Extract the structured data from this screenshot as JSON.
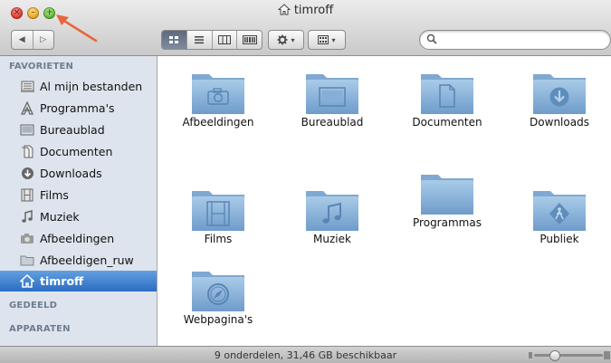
{
  "window": {
    "title": "timroff"
  },
  "toolbar": {
    "back": "◀",
    "forward": "▷",
    "search_placeholder": ""
  },
  "sidebar": {
    "favorites_header": "FAVORIETEN",
    "items": [
      {
        "label": "Al mijn bestanden",
        "icon": "all-files-icon"
      },
      {
        "label": "Programma's",
        "icon": "applications-icon"
      },
      {
        "label": "Bureaublad",
        "icon": "desktop-icon"
      },
      {
        "label": "Documenten",
        "icon": "documents-icon"
      },
      {
        "label": "Downloads",
        "icon": "downloads-icon"
      },
      {
        "label": "Films",
        "icon": "movies-icon"
      },
      {
        "label": "Muziek",
        "icon": "music-icon"
      },
      {
        "label": "Afbeeldingen",
        "icon": "pictures-icon"
      },
      {
        "label": "Afbeeldigen_ruw",
        "icon": "folder-icon"
      },
      {
        "label": "timroff",
        "icon": "home-icon",
        "selected": true
      }
    ],
    "shared_header": "GEDEELD",
    "devices_header": "APPARATEN"
  },
  "content": {
    "folders": [
      {
        "label": "Afbeeldingen",
        "emblem": "camera-icon"
      },
      {
        "label": "Bureaublad",
        "emblem": "desktop-icon"
      },
      {
        "label": "Documenten",
        "emblem": "document-icon"
      },
      {
        "label": "Downloads",
        "emblem": "download-icon"
      },
      {
        "label": "Films",
        "emblem": "film-icon"
      },
      {
        "label": "Muziek",
        "emblem": "music-note-icon"
      },
      {
        "label": "Programmas",
        "emblem": "none"
      },
      {
        "label": "Publiek",
        "emblem": "public-icon"
      },
      {
        "label": "Webpagina's",
        "emblem": "compass-icon"
      }
    ]
  },
  "statusbar": {
    "text": "9 onderdelen, 31,46 GB beschikbaar"
  },
  "colors": {
    "sidebar_bg": "#dde4ed",
    "selection": "#2b6cc2",
    "folder": "#8fb5d9",
    "annotation_arrow": "#e8663d"
  }
}
